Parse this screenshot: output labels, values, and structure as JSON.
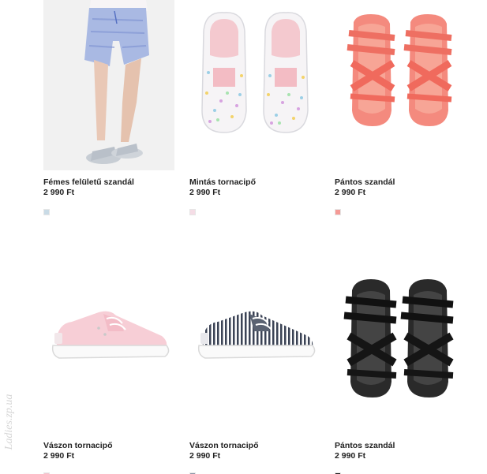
{
  "products": [
    {
      "name": "Fémes felületű szandál",
      "price": "2 990 Ft",
      "swatch_color": "#c9dbe6",
      "image_icon": "metallic-sandal-on-child-photo"
    },
    {
      "name": "Mintás tornacipő",
      "price": "2 990 Ft",
      "swatch_color": "#f5dde6",
      "image_icon": "patterned-slip-on-sneakers"
    },
    {
      "name": "Pántos szandál",
      "price": "2 990 Ft",
      "swatch_color": "#f59a96",
      "image_icon": "coral-strap-sandals"
    },
    {
      "name": "Vászon tornacipő",
      "price": "2 990 Ft",
      "swatch_color": "#f3c4cf",
      "image_icon": "pink-canvas-sneaker"
    },
    {
      "name": "Vászon tornacipő",
      "price": "2 990 Ft",
      "swatch_color": "#8c96a8",
      "image_icon": "striped-canvas-sneaker"
    },
    {
      "name": "Pántos szandál",
      "price": "2 990 Ft",
      "swatch_color": "#222222",
      "image_icon": "black-strap-sandals"
    }
  ],
  "watermark": "Ladies.zp.ua"
}
